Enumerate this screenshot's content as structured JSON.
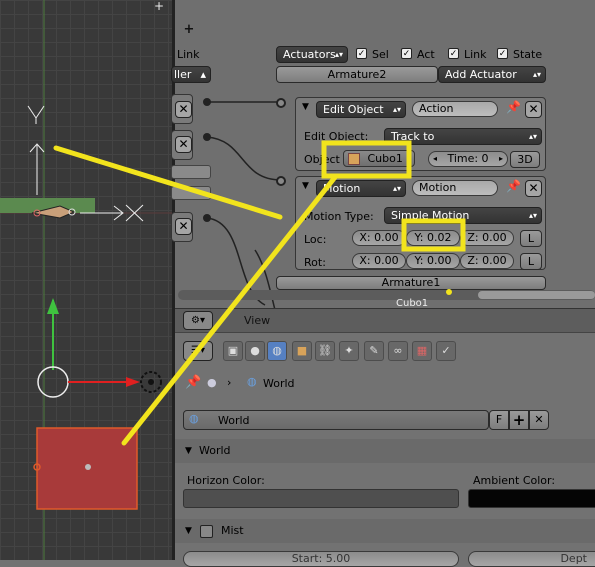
{
  "viewport": {
    "axis_y_label": "Y",
    "colors": {
      "grid_bg": "#393939",
      "green_bar": "#5b8a4f",
      "red_cube": "#a83a3a",
      "green_arrow": "#3fc23f",
      "red_arrow": "#e02020"
    }
  },
  "logic": {
    "top_left": {
      "link_label": "Link",
      "controller_dropdown": "ller"
    },
    "actuators_header": {
      "dropdown": "Actuators",
      "sel_label": "Sel",
      "act_label": "Act",
      "link_label": "Link",
      "state_label": "State",
      "object_name": "Armature2",
      "add_actuator": "Add Actuator"
    },
    "actuator1": {
      "type": "Edit Object",
      "name": "Action",
      "edit_object_label": "Edit Object:",
      "edit_object_value": "Track to",
      "object_label": "Object",
      "object_value": "Cubo1",
      "time_label": "Time: 0",
      "btn_3d": "3D"
    },
    "actuator2": {
      "type": "Motion",
      "name": "Motion",
      "motion_type_label": "Motion Type:",
      "motion_type_value": "Simple Motion",
      "loc_label": "Loc:",
      "loc": [
        "X: 0.00",
        "Y: 0.02",
        "Z: 0.00"
      ],
      "rot_label": "Rot:",
      "rot": [
        "X: 0.00",
        "Y: 0.00",
        "Z: 0.00"
      ],
      "l_button": "L"
    },
    "footer_object": "Armature1",
    "footer_partial": "Cubo1"
  },
  "props_header": {
    "view_label": "View"
  },
  "properties": {
    "breadcrumb": "World",
    "world_field": "World",
    "fake_user": "F",
    "world_section": "World",
    "horizon_color_label": "Horizon Color:",
    "ambient_color_label": "Ambient Color:",
    "mist_section": "Mist",
    "start_field": "Start: 5.00",
    "depth_field": "Dept"
  },
  "annotation": {
    "color": "#f2e41d"
  }
}
